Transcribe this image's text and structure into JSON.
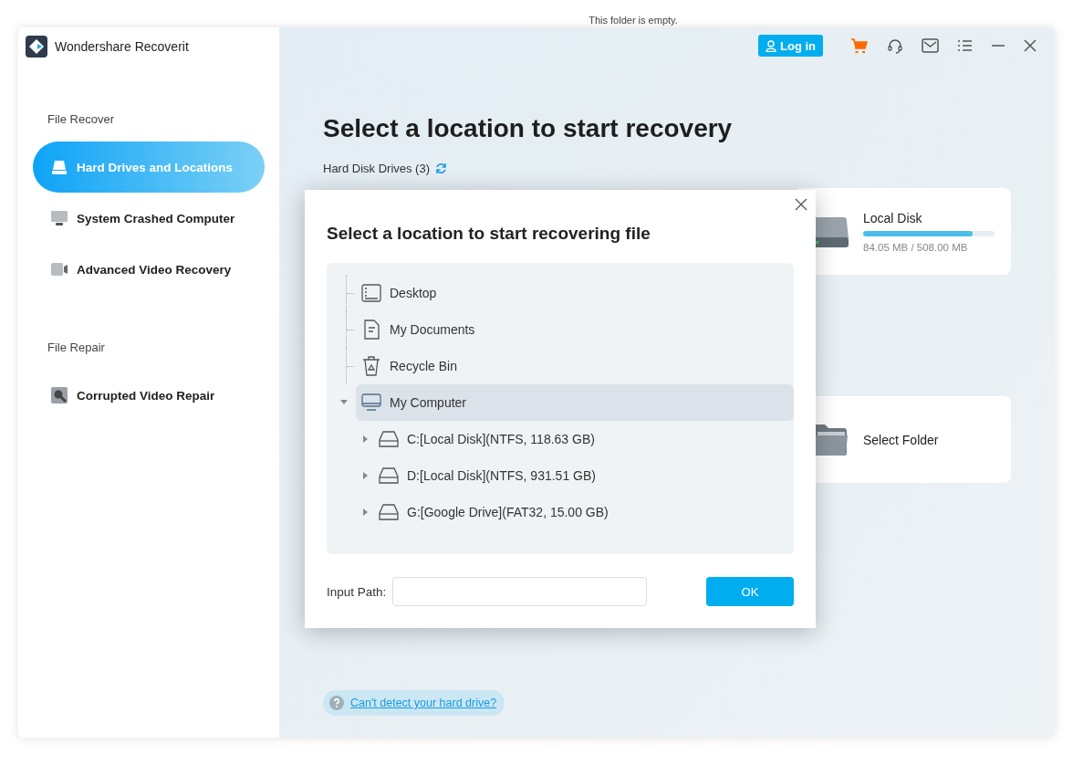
{
  "top_note": "This folder is empty.",
  "app": {
    "title": "Wondershare Recoverit"
  },
  "sidebar": {
    "sections": [
      {
        "heading": "File Recover",
        "items": [
          {
            "label": "Hard Drives and Locations",
            "kind": "drive",
            "selected": true
          },
          {
            "label": "System Crashed Computer",
            "kind": "computer",
            "selected": false
          },
          {
            "label": "Advanced Video Recovery",
            "kind": "video",
            "selected": false
          }
        ]
      },
      {
        "heading": "File Repair",
        "items": [
          {
            "label": "Corrupted Video Repair",
            "kind": "repair",
            "selected": false
          }
        ]
      }
    ]
  },
  "toolbar": {
    "login": "Log in"
  },
  "main": {
    "title": "Select a location to start recovery",
    "drives_heading": "Hard Disk Drives (3)",
    "drive_cards": [
      {
        "name": "Local Disk",
        "usage": "84.05 MB / 508.00 MB",
        "level": 0.83
      }
    ],
    "location_cards": [
      {
        "label": "Select Folder"
      }
    ],
    "help_link": "Can't detect your hard drive?"
  },
  "dialog": {
    "title": "Select a location to start recovering file",
    "tree": [
      {
        "label": "Desktop",
        "kind": "desktop",
        "selected": false
      },
      {
        "label": "My Documents",
        "kind": "document",
        "selected": false
      },
      {
        "label": "Recycle Bin",
        "kind": "recycle",
        "selected": false
      },
      {
        "label": "My Computer",
        "kind": "computer",
        "selected": true,
        "expanded": true,
        "children": [
          {
            "label": "C:[Local Disk](NTFS, 118.63 GB)",
            "kind": "drive",
            "selected": false,
            "expanded": false
          },
          {
            "label": "D:[Local Disk](NTFS, 931.51 GB)",
            "kind": "drive",
            "selected": false,
            "expanded": false
          },
          {
            "label": "G:[Google Drive](FAT32, 15.00 GB)",
            "kind": "drive",
            "selected": false,
            "expanded": false
          }
        ]
      }
    ],
    "input_label": "Input Path:",
    "ok": "OK"
  }
}
